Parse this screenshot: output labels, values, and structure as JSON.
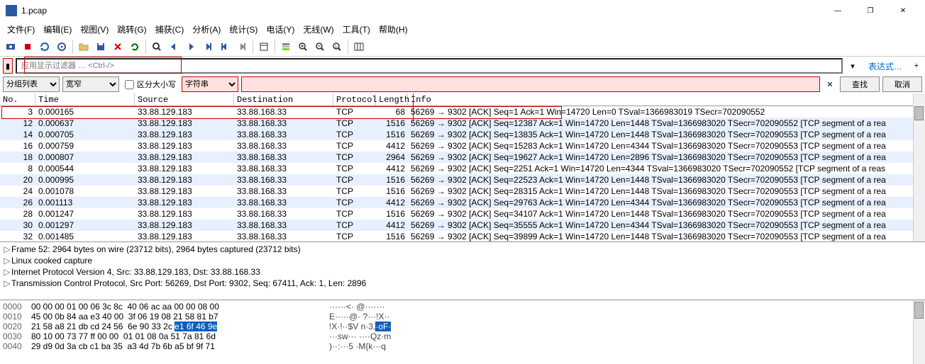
{
  "window": {
    "title": "1.pcap",
    "minimize": "—",
    "maximize": "❐",
    "close": "✕"
  },
  "menu": [
    "文件(F)",
    "编辑(E)",
    "视图(V)",
    "跳转(G)",
    "捕获(C)",
    "分析(A)",
    "统计(S)",
    "电话(Y)",
    "无线(W)",
    "工具(T)",
    "帮助(H)"
  ],
  "filter": {
    "placeholder": "应用显示过滤器 … <Ctrl-/>",
    "expr": "表达式…"
  },
  "search": {
    "view": "分组列表",
    "width": "宽窄",
    "case": "区分大小写",
    "type": "字符串",
    "find": "查找",
    "cancel": "取消"
  },
  "columns": [
    "No.",
    "Time",
    "Source",
    "Destination",
    "Protocol",
    "Length",
    "Info"
  ],
  "packets": [
    {
      "no": "3",
      "time": "0.000165",
      "src": "33.88.129.183",
      "dst": "33.88.168.33",
      "proto": "TCP",
      "len": "68",
      "info": "56269 → 9302 [ACK] Seq=1 Ack=1 Win=14720 Len=0 TSval=1366983019 TSecr=702090552",
      "alt": false
    },
    {
      "no": "12",
      "time": "0.000637",
      "src": "33.88.129.183",
      "dst": "33.88.168.33",
      "proto": "TCP",
      "len": "1516",
      "info": "56269 → 9302 [ACK] Seq=12387 Ack=1 Win=14720 Len=1448 TSval=1366983020 TSecr=702090552 [TCP segment of a rea",
      "alt": true
    },
    {
      "no": "14",
      "time": "0.000705",
      "src": "33.88.129.183",
      "dst": "33.88.168.33",
      "proto": "TCP",
      "len": "1516",
      "info": "56269 → 9302 [ACK] Seq=13835 Ack=1 Win=14720 Len=1448 TSval=1366983020 TSecr=702090553 [TCP segment of a rea",
      "alt": true
    },
    {
      "no": "16",
      "time": "0.000759",
      "src": "33.88.129.183",
      "dst": "33.88.168.33",
      "proto": "TCP",
      "len": "4412",
      "info": "56269 → 9302 [ACK] Seq=15283 Ack=1 Win=14720 Len=4344 TSval=1366983020 TSecr=702090553 [TCP segment of a rea",
      "alt": false
    },
    {
      "no": "18",
      "time": "0.000807",
      "src": "33.88.129.183",
      "dst": "33.88.168.33",
      "proto": "TCP",
      "len": "2964",
      "info": "56269 → 9302 [ACK] Seq=19627 Ack=1 Win=14720 Len=2896 TSval=1366983020 TSecr=702090553 [TCP segment of a rea",
      "alt": true
    },
    {
      "no": "8",
      "time": "0.000544",
      "src": "33.88.129.183",
      "dst": "33.88.168.33",
      "proto": "TCP",
      "len": "4412",
      "info": "56269 → 9302 [ACK] Seq=2251 Ack=1 Win=14720 Len=4344 TSval=1366983020 TSecr=702090552 [TCP segment of a reas",
      "alt": false
    },
    {
      "no": "20",
      "time": "0.000995",
      "src": "33.88.129.183",
      "dst": "33.88.168.33",
      "proto": "TCP",
      "len": "1516",
      "info": "56269 → 9302 [ACK] Seq=22523 Ack=1 Win=14720 Len=1448 TSval=1366983020 TSecr=702090553 [TCP segment of a rea",
      "alt": true
    },
    {
      "no": "24",
      "time": "0.001078",
      "src": "33.88.129.183",
      "dst": "33.88.168.33",
      "proto": "TCP",
      "len": "1516",
      "info": "56269 → 9302 [ACK] Seq=28315 Ack=1 Win=14720 Len=1448 TSval=1366983020 TSecr=702090553 [TCP segment of a rea",
      "alt": false
    },
    {
      "no": "26",
      "time": "0.001113",
      "src": "33.88.129.183",
      "dst": "33.88.168.33",
      "proto": "TCP",
      "len": "4412",
      "info": "56269 → 9302 [ACK] Seq=29763 Ack=1 Win=14720 Len=4344 TSval=1366983020 TSecr=702090553 [TCP segment of a rea",
      "alt": true
    },
    {
      "no": "28",
      "time": "0.001247",
      "src": "33.88.129.183",
      "dst": "33.88.168.33",
      "proto": "TCP",
      "len": "1516",
      "info": "56269 → 9302 [ACK] Seq=34107 Ack=1 Win=14720 Len=1448 TSval=1366983020 TSecr=702090553 [TCP segment of a rea",
      "alt": false
    },
    {
      "no": "30",
      "time": "0.001297",
      "src": "33.88.129.183",
      "dst": "33.88.168.33",
      "proto": "TCP",
      "len": "4412",
      "info": "56269 → 9302 [ACK] Seq=35555 Ack=1 Win=14720 Len=4344 TSval=1366983020 TSecr=702090553 [TCP segment of a rea",
      "alt": true
    },
    {
      "no": "32",
      "time": "0.001485",
      "src": "33.88.129.183",
      "dst": "33.88.168.33",
      "proto": "TCP",
      "len": "1516",
      "info": "56269 → 9302 [ACK] Seq=39899 Ack=1 Win=14720 Len=1448 TSval=1366983020 TSecr=702090553 [TCP segment of a rea",
      "alt": false
    }
  ],
  "details": [
    "Frame 52: 2964 bytes on wire (23712 bits), 2964 bytes captured (23712 bits)",
    "Linux cooked capture",
    "Internet Protocol Version 4, Src: 33.88.129.183, Dst: 33.88.168.33",
    "Transmission Control Protocol, Src Port: 56269, Dst Port: 9302, Seq: 67411, Ack: 1, Len: 2896"
  ],
  "hex": [
    {
      "off": "0000",
      "b": "00 00 00 01 00 06 3c 8c  40 06 ac aa 00 00 08 00",
      "a": "······<· @·······"
    },
    {
      "off": "0010",
      "b": "45 00 0b 84 aa e3 40 00  3f 06 19 08 21 58 81 b7",
      "a": "E·····@· ?···!X··"
    },
    {
      "off": "0020",
      "b": "21 58 a8 21 db cd 24 56  6e 90 33 2c ",
      "hl": "e1 6f 46 9e",
      "a": "!X·!··$V n·3,",
      "ahl": "·oF·"
    },
    {
      "off": "0030",
      "b": "80 10 00 73 77 ff 00 00  01 01 08 0a 51 7a 81 6d",
      "a": "···sw··· ····Qz·m"
    },
    {
      "off": "0040",
      "b": "29 d9 0d 3a cb c1 ba 35  a3 4d 7b 6b a5 bf 9f 71",
      "a": ")··:···5 ·M{k···q"
    }
  ]
}
